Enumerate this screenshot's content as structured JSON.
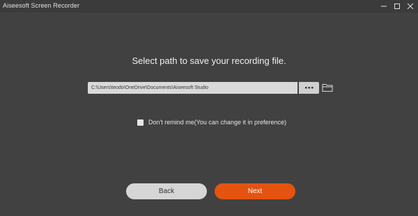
{
  "window": {
    "title": "Aiseesoft Screen Recorder"
  },
  "titlebar_controls": {
    "minimize_icon": "minimize-icon",
    "maximize_icon": "maximize-icon",
    "close_icon": "close-icon"
  },
  "main": {
    "heading": "Select path to save your recording file.",
    "path_value": "C:\\Users\\teodo\\OneDrive\\Documents\\Aiseesoft Studio",
    "browse_icon": "more-dots-icon",
    "open_folder_icon": "folder-icon",
    "remind_checked": false,
    "remind_label": "Don't remind me(You can change it in preference)"
  },
  "footer": {
    "back_label": "Back",
    "next_label": "Next"
  },
  "colors": {
    "background": "#414141",
    "accent": "#e55310",
    "secondary_button": "#d6d6d6"
  }
}
